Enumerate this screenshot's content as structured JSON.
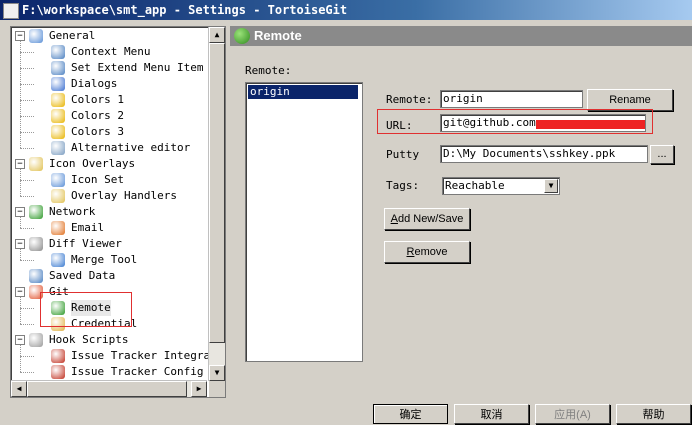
{
  "window": {
    "title": "F:\\workspace\\smt_app - Settings - TortoiseGit"
  },
  "tree": {
    "items": [
      {
        "label": "General",
        "icon": "wrench-icon",
        "color": "#5a8fd6"
      },
      {
        "label": "Context Menu",
        "icon": "gear-icon",
        "color": "#4a7fc0"
      },
      {
        "label": "Set Extend Menu Item",
        "icon": "gear-icon",
        "color": "#4a7fc0"
      },
      {
        "label": "Dialogs",
        "icon": "windows-icon",
        "color": "#3b6fd0"
      },
      {
        "label": "Colors 1",
        "icon": "paint-brush-icon",
        "color": "#e8b400"
      },
      {
        "label": "Colors 2",
        "icon": "paint-brush-icon",
        "color": "#e8b400"
      },
      {
        "label": "Colors 3",
        "icon": "paint-brush-icon",
        "color": "#e8b400"
      },
      {
        "label": "Alternative editor",
        "icon": "magnifier-icon",
        "color": "#7a9cc0"
      },
      {
        "label": "Icon Overlays",
        "icon": "folder-icon",
        "color": "#e0c050"
      },
      {
        "label": "Icon Set",
        "icon": "icon-set-icon",
        "color": "#5a8fd6"
      },
      {
        "label": "Overlay Handlers",
        "icon": "folder-icon",
        "color": "#e0c050"
      },
      {
        "label": "Network",
        "icon": "globe-icon",
        "color": "#2f9a2a"
      },
      {
        "label": "Email",
        "icon": "at-sign-icon",
        "color": "#e07020"
      },
      {
        "label": "Diff Viewer",
        "icon": "diff-icon",
        "color": "#8a8a8a"
      },
      {
        "label": "Merge Tool",
        "icon": "merge-icon",
        "color": "#3a7ad0"
      },
      {
        "label": "Saved Data",
        "icon": "gear-icon",
        "color": "#4a7fc0"
      },
      {
        "label": "Git",
        "icon": "git-icon",
        "color": "#e0502a"
      },
      {
        "label": "Remote",
        "icon": "globe-icon",
        "color": "#2f9a2a"
      },
      {
        "label": "Credential",
        "icon": "lock-icon",
        "color": "#e0b040"
      },
      {
        "label": "Hook Scripts",
        "icon": "hook-icon",
        "color": "#9a9a9a"
      },
      {
        "label": "Issue Tracker Integrat",
        "icon": "bug-icon",
        "color": "#c03020"
      },
      {
        "label": "Issue Tracker Config",
        "icon": "bug-icon",
        "color": "#c03020"
      }
    ]
  },
  "panel": {
    "header": "Remote",
    "remote_list_label": "Remote:",
    "remotes": [
      "origin"
    ],
    "remote_label": "Remote:",
    "remote_value": "origin",
    "rename_button": "Rename",
    "url_label": "URL:",
    "url_value": "git@github.com:",
    "putty_label": "Putty",
    "putty_value": "D:\\My Documents\\sshkey.ppk",
    "browse_button": "...",
    "tags_label": "Tags:",
    "tags_value": "Reachable",
    "add_new_save_button": {
      "underlined": "A",
      "rest": "dd New/Save"
    },
    "remove_button": {
      "underlined": "R",
      "rest": "emove"
    }
  },
  "footer": {
    "ok": "确定",
    "cancel": "取消",
    "apply": "应用(A)",
    "help": "帮助"
  },
  "colors": {
    "annotation_red": "#e03030",
    "selection": "#0a246a"
  }
}
